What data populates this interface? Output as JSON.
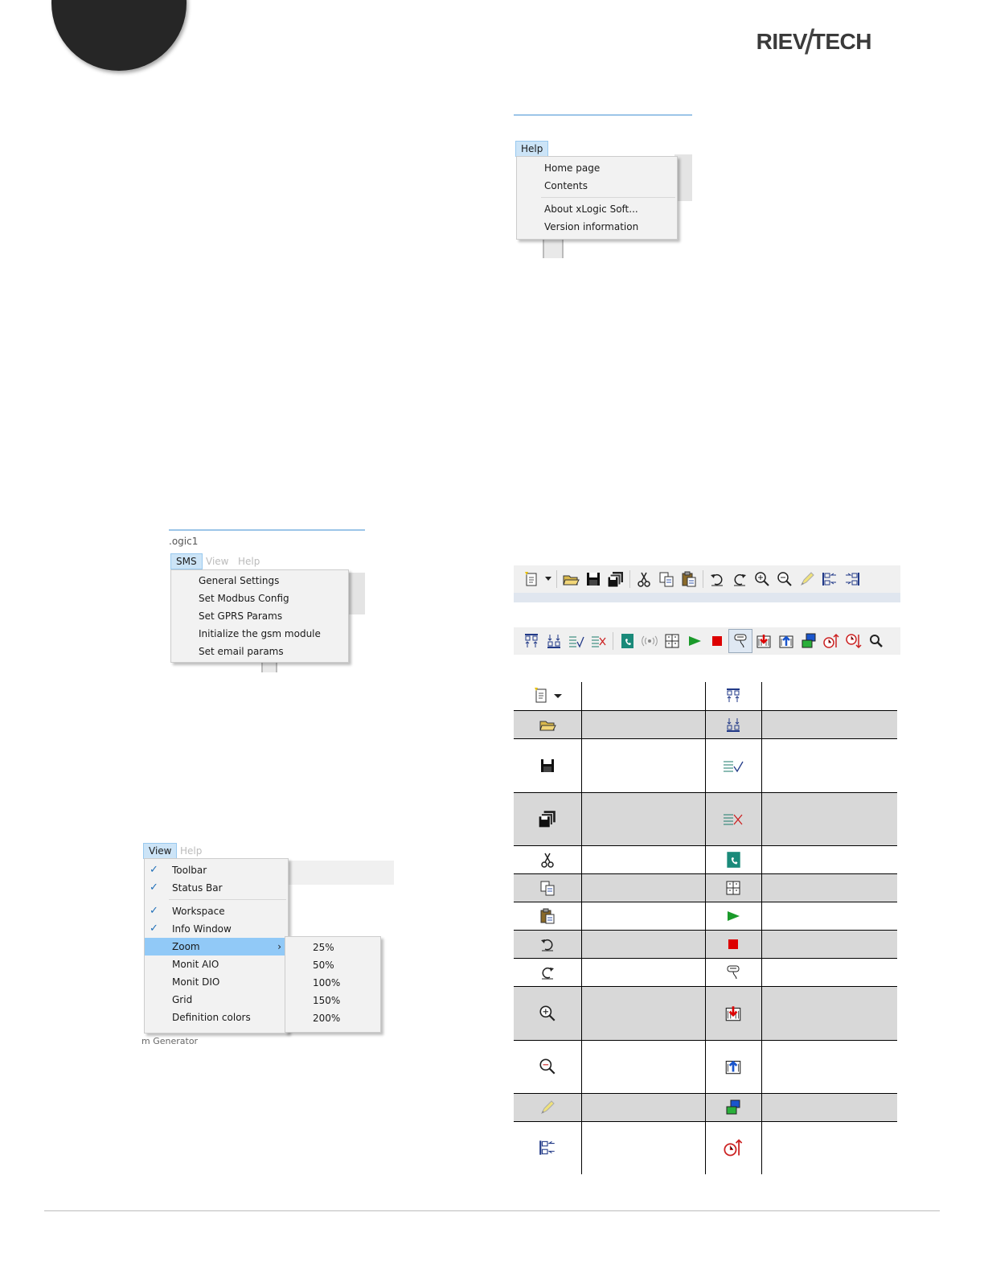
{
  "header": {
    "logo_text_left": "RIEV",
    "logo_slash": "/",
    "logo_text_right": "TECH"
  },
  "help_menu_shot": {
    "menu_label": "Help",
    "items": [
      "Home page",
      "Contents",
      "About xLogic Soft...",
      "Version information"
    ]
  },
  "sms_menu_shot": {
    "title_fragment": ".ogic1",
    "menu_labels": [
      "SMS",
      "View",
      "Help"
    ],
    "items": [
      "General Settings",
      "Set Modbus Config",
      "Set GPRS Params",
      "Initialize the gsm module",
      "Set email params"
    ]
  },
  "view_menu_shot": {
    "menu_labels": [
      "View",
      "Help"
    ],
    "items": [
      {
        "label": "Toolbar",
        "checked": true
      },
      {
        "label": "Status Bar",
        "checked": true
      },
      {
        "label": "Workspace",
        "checked": true
      },
      {
        "label": "Info Window",
        "checked": true
      },
      {
        "label": "Zoom",
        "checked": false,
        "submenu": true
      },
      {
        "label": "Monit AIO",
        "checked": false
      },
      {
        "label": "Monit DIO",
        "checked": false
      },
      {
        "label": "Grid",
        "checked": false
      },
      {
        "label": "Definition colors",
        "checked": false
      }
    ],
    "zoom_options": [
      "25%",
      "50%",
      "100%",
      "150%",
      "200%"
    ],
    "below_fragment": "m Generator"
  },
  "toolbar1_icons": [
    "new-icon",
    "dropdown-arrow-icon",
    "open-icon",
    "save-icon",
    "save-all-icon",
    "cut-icon",
    "copy-icon",
    "paste-icon",
    "undo-icon",
    "redo-icon",
    "zoom-in-icon",
    "zoom-out-icon",
    "pencil-icon",
    "align-left-icon",
    "align-right-icon"
  ],
  "toolbar2_icons": [
    "align-top-icon",
    "align-bottom-icon",
    "check-lines-icon",
    "delete-lines-icon",
    "phone-book-icon",
    "signal-icon",
    "grid-icon",
    "run-icon",
    "stop-icon",
    "cable-icon",
    "download-icon",
    "upload-icon",
    "transfer-icon",
    "clock-up-icon",
    "clock-down-icon",
    "search-icon"
  ],
  "icon_table_rows": [
    {
      "left": "new-icon",
      "right": "align-top-icon"
    },
    {
      "left": "open-icon",
      "right": "align-bottom-icon"
    },
    {
      "left": "save-icon",
      "right": "check-lines-icon"
    },
    {
      "left": "save-all-icon",
      "right": "delete-lines-icon"
    },
    {
      "left": "cut-icon",
      "right": "phone-book-icon"
    },
    {
      "left": "copy-icon",
      "right": "grid-icon"
    },
    {
      "left": "paste-icon",
      "right": "run-icon"
    },
    {
      "left": "undo-icon",
      "right": "stop-icon"
    },
    {
      "left": "redo-icon",
      "right": "cable-icon"
    },
    {
      "left": "zoom-in-icon",
      "right": "download-icon"
    },
    {
      "left": "zoom-out-icon",
      "right": "upload-icon"
    },
    {
      "left": "pencil-icon",
      "right": "transfer-icon"
    },
    {
      "left": "align-left-icon",
      "right": "clock-up-icon"
    }
  ],
  "colors": {
    "menu_highlight": "#91c9f7",
    "table_shade": "#d8d8d8",
    "dark_circle": "#262626"
  }
}
